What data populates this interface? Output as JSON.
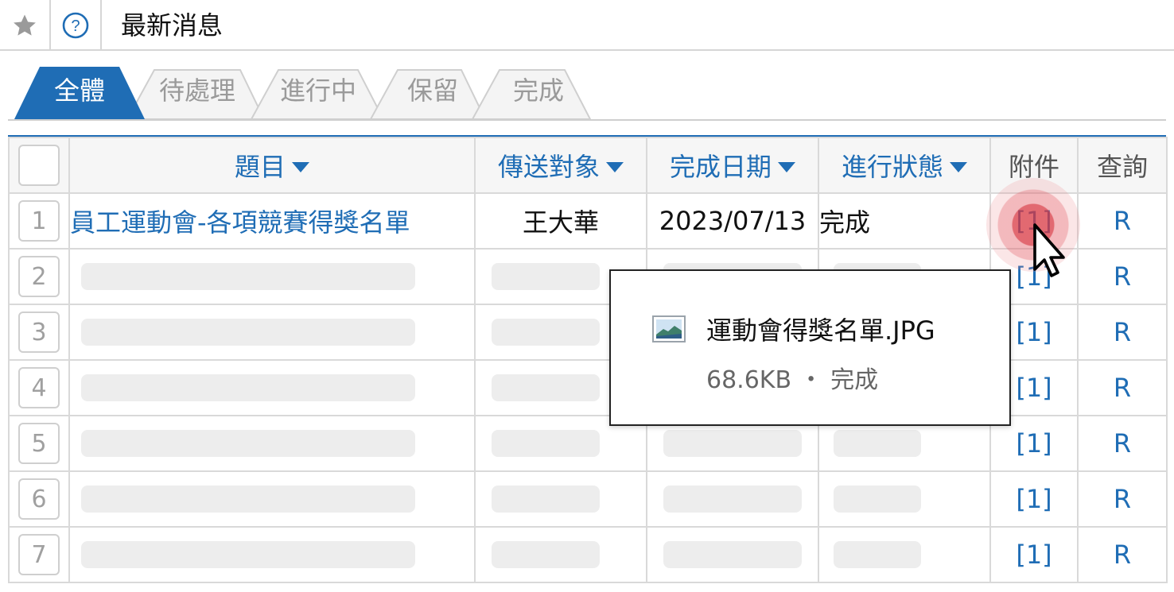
{
  "header": {
    "title": "最新消息",
    "star_icon": "★",
    "help_icon": "?"
  },
  "tabs": [
    {
      "label": "全體",
      "active": true
    },
    {
      "label": "待處理",
      "active": false
    },
    {
      "label": "進行中",
      "active": false
    },
    {
      "label": "保留",
      "active": false
    },
    {
      "label": "完成",
      "active": false
    }
  ],
  "table": {
    "columns": [
      "題目",
      "傳送對象",
      "完成日期",
      "進行狀態",
      "附件",
      "查詢"
    ],
    "rows": [
      {
        "num": "1",
        "title": "員工運動會-各項競賽得獎名單",
        "recipient": "王大華",
        "date": "2023/07/13",
        "status": "完成",
        "attachment": "[1]",
        "query": "R"
      },
      {
        "num": "2",
        "attachment": "[1]",
        "query": "R"
      },
      {
        "num": "3",
        "attachment": "[1]",
        "query": "R"
      },
      {
        "num": "4",
        "attachment": "[1]",
        "query": "R"
      },
      {
        "num": "5",
        "attachment": "[1]",
        "query": "R"
      },
      {
        "num": "6",
        "attachment": "[1]",
        "query": "R"
      },
      {
        "num": "7",
        "attachment": "[1]",
        "query": "R"
      }
    ]
  },
  "popover": {
    "file_name": "運動會得獎名單.JPG",
    "file_meta": "68.6KB ・ 完成",
    "icon": "image-file-icon"
  },
  "colors": {
    "accent": "#1f6db5",
    "hover_ring": "#d83741",
    "placeholder": "#ededed",
    "border": "#d9d9d9"
  }
}
